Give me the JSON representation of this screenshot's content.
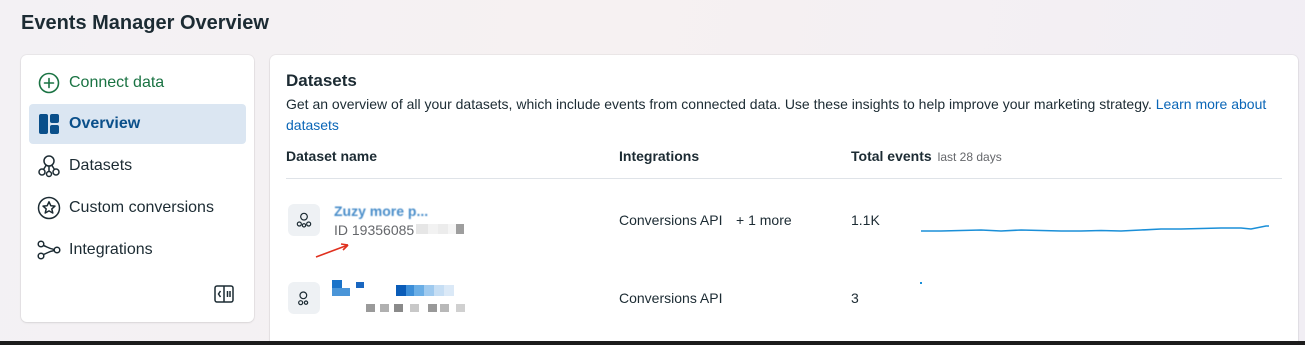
{
  "page": {
    "title": "Events Manager Overview"
  },
  "sidebar": {
    "items": [
      {
        "label": "Connect data",
        "icon": "plus-circle-icon"
      },
      {
        "label": "Overview",
        "icon": "overview-grid-icon",
        "selected": true
      },
      {
        "label": "Datasets",
        "icon": "datasets-icon"
      },
      {
        "label": "Custom conversions",
        "icon": "star-circle-icon"
      },
      {
        "label": "Integrations",
        "icon": "integrations-icon"
      }
    ],
    "collapse_icon": "collapse-sidebar-icon"
  },
  "datasets": {
    "title": "Datasets",
    "description": "Get an overview of all your datasets, which include events from connected data. Use these insights to help improve your marketing strategy.",
    "learn_more": "Learn more about datasets",
    "columns": {
      "name": "Dataset name",
      "integrations": "Integrations",
      "total_events": "Total events",
      "total_events_sub": "last 28 days"
    },
    "rows": [
      {
        "name": "Zuzy more p...",
        "id": "ID 19356085",
        "integration": "Conversions API",
        "more": "+ 1 more",
        "total": "1.1K"
      },
      {
        "name": "",
        "id": "",
        "integration": "Conversions API",
        "more": "",
        "total": "3"
      }
    ]
  },
  "colors": {
    "accent_blue": "#0a66b7",
    "selected_bg": "#dbe6f2",
    "connect_green": "#1a7343",
    "sparkline": "#1a8fd8",
    "annotation_arrow": "#e0301e"
  }
}
